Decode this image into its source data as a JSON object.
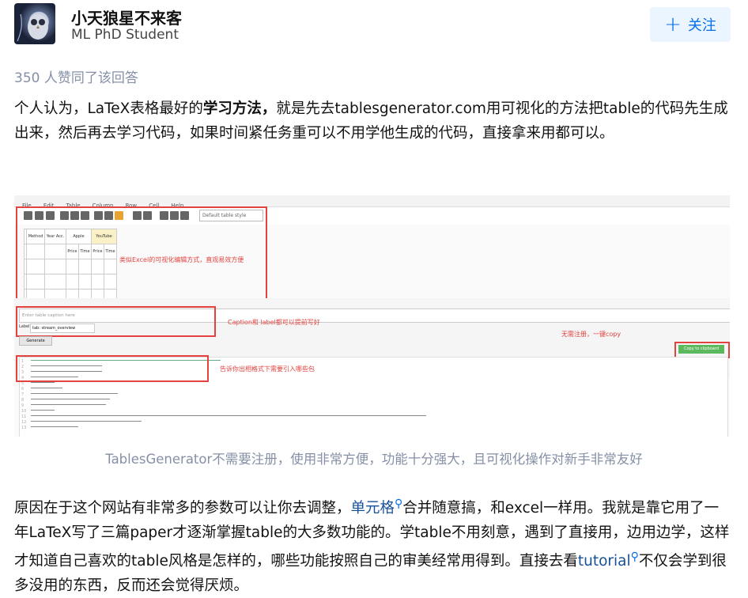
{
  "author": {
    "name": "小天狼星不来客",
    "bio": "ML PhD Student",
    "follow_label": "关注",
    "follow_icon": "plus-icon"
  },
  "upvote_text": "350 人赞同了该回答",
  "paragraph1": {
    "before": "个人认为，LaTeX表格最好的",
    "bold": "学习方法，",
    "after": "就是先去tablesgenerator.com用可视化的方法把table的代码先生成出来，然后再去学习代码，如果时间紧任务重可以不用学他生成的代码，直接拿来用都可以。"
  },
  "screenshot": {
    "menu_items": [
      "File",
      "Edit",
      "Table",
      "Column",
      "Row",
      "Cell",
      "Help"
    ],
    "table_style": "Default table style",
    "annotations": {
      "grid": "类似Excel的可视化编辑方式，直观易效方便",
      "caption": "Caption和 label都可以提前写好",
      "copy": "无需注册，一键copy",
      "packages": "告诉你出相格式下需要引入哪些包"
    },
    "caption_placeholder": "Enter table caption here",
    "label_prefix": "Label",
    "label_value": "tab: stream_overview",
    "generate_label": "Generate",
    "copy_label": "Copy to clipboard",
    "grid_cells": {
      "method": "Method",
      "year": "Year Acc.",
      "apple": "Apple",
      "youtube": "YouTube",
      "price": "Price",
      "time": "Time"
    }
  },
  "image_caption": "TablesGenerator不需要注册，使用非常方便，功能十分强大，且可视化操作对新手非常友好",
  "paragraph2": {
    "part1": "原因在于这个网站有非常多的参数可以让你去调整，",
    "link1": "单元格",
    "part2": "合并随意搞，和excel一样用。我就是靠它用了一年LaTeX写了三篇paper才逐渐掌握table的大多数功能的。学table不用刻意，遇到了直接用，边用边学，这样才知道自己喜欢的table风格是怎样的，哪些功能按照自己的审美经常用得到。直接去看",
    "link2": "tutorial",
    "part3": "不仅会学到很多没用的东西，反而还会觉得厌烦。"
  },
  "colors": {
    "accent": "#056de8",
    "annotation_red": "#e3423e",
    "muted": "#8590a6"
  }
}
